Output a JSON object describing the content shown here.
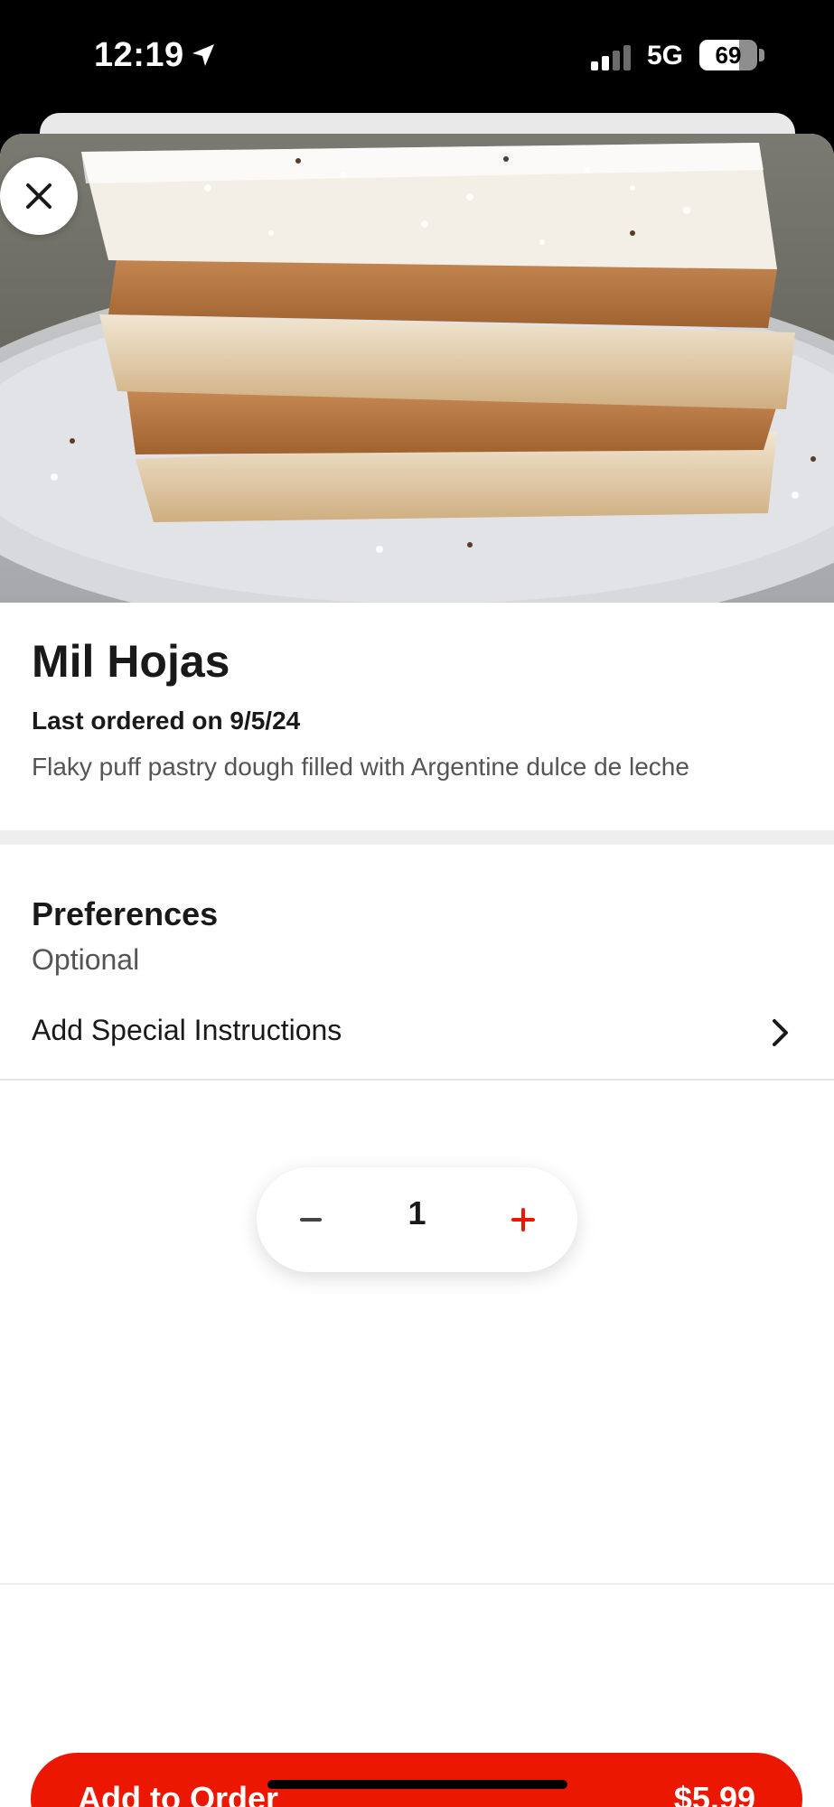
{
  "status_bar": {
    "time": "12:19",
    "network": "5G",
    "battery_level": "69",
    "battery_fraction": 0.69
  },
  "item": {
    "image_alt": "Mil Hojas pastry photo",
    "title": "Mil Hojas",
    "last_ordered": "Last ordered on 9/5/24",
    "description": "Flaky puff pastry dough filled with Argentine dulce de leche"
  },
  "preferences": {
    "title": "Preferences",
    "subtitle": "Optional",
    "special_instructions_label": "Add Special Instructions"
  },
  "quantity": {
    "value": "1"
  },
  "footer": {
    "add_label": "Add to Order",
    "price": "$5.99"
  },
  "colors": {
    "accent": "#eb1700",
    "text_primary": "#191919",
    "text_secondary": "#555555"
  },
  "icons": {
    "close": "close-icon",
    "chevron": "chevron-right-icon",
    "minus": "minus-icon",
    "plus": "plus-icon",
    "location": "location-arrow-icon",
    "signal": "signal-icon",
    "battery": "battery-icon"
  }
}
